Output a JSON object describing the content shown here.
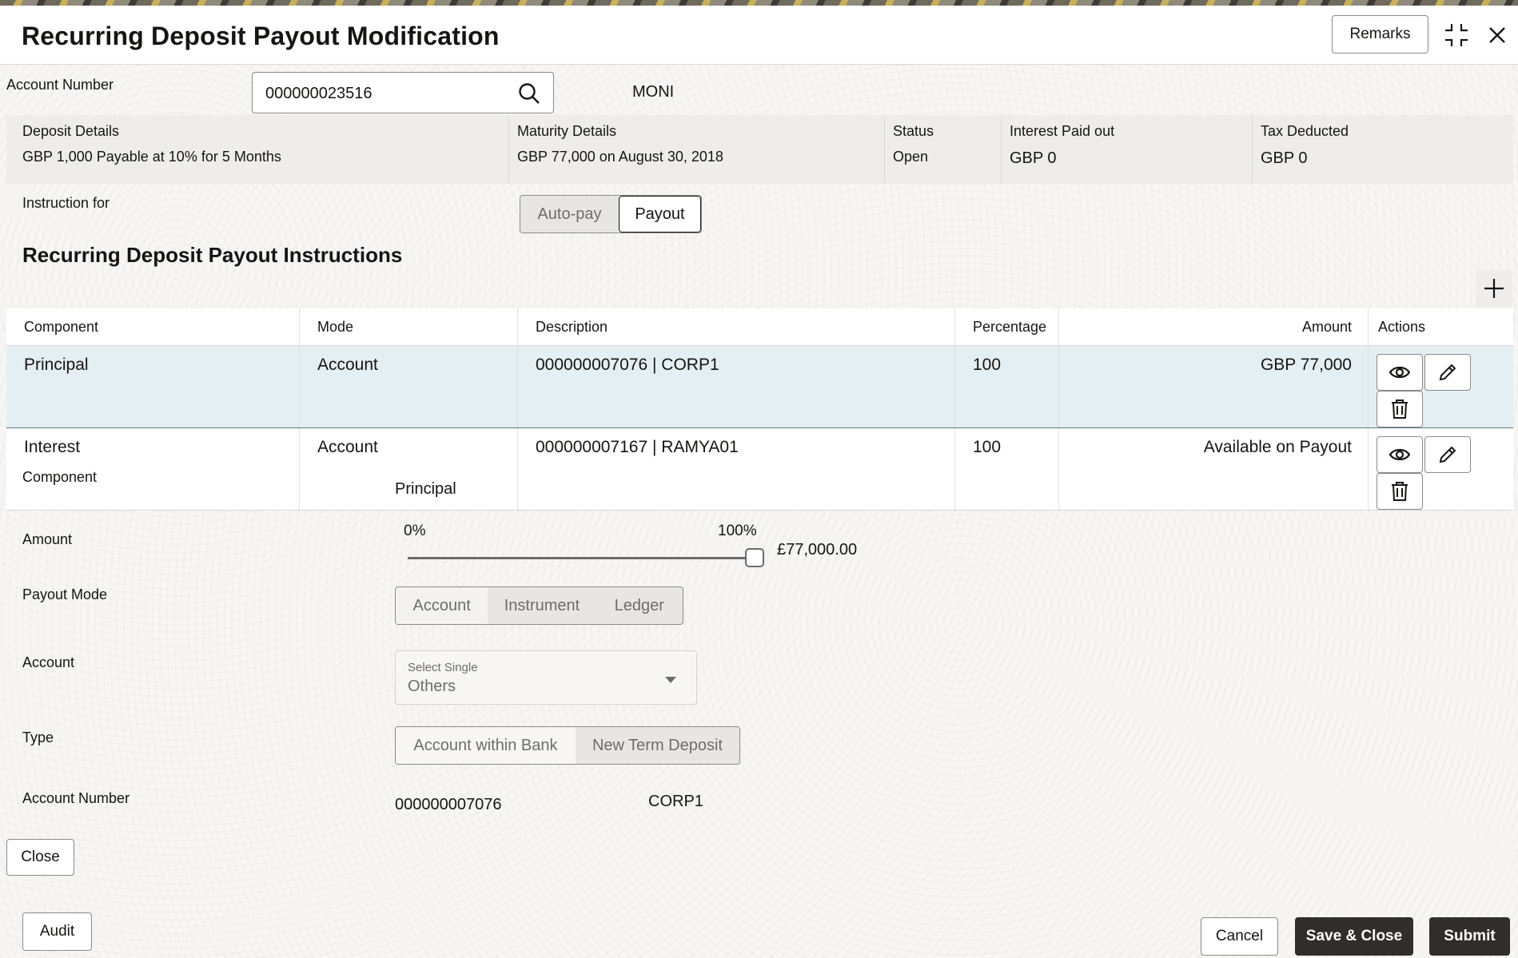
{
  "header": {
    "title": "Recurring Deposit Payout Modification",
    "remarks_label": "Remarks"
  },
  "account": {
    "label": "Account Number",
    "value": "000000023516",
    "name": "MONI"
  },
  "summary": {
    "deposit_details_label": "Deposit Details",
    "deposit_details_value": "GBP 1,000 Payable at 10% for 5 Months",
    "maturity_details_label": "Maturity Details",
    "maturity_details_value": "GBP 77,000 on August 30, 2018",
    "status_label": "Status",
    "status_value": "Open",
    "interest_paid_label": "Interest Paid out",
    "interest_paid_value": "GBP 0",
    "tax_deducted_label": "Tax Deducted",
    "tax_deducted_value": "GBP 0"
  },
  "instruction": {
    "label": "Instruction for",
    "options": [
      "Auto-pay",
      "Payout"
    ],
    "selected": "Payout"
  },
  "section_title": "Recurring Deposit Payout Instructions",
  "table": {
    "headers": [
      "Component",
      "Mode",
      "Description",
      "Percentage",
      "Amount",
      "Actions"
    ],
    "rows": [
      {
        "component": "Principal",
        "mode": "Account",
        "description": "000000007076 | CORP1",
        "percentage": "100",
        "amount": "GBP  77,000"
      },
      {
        "component": "Interest",
        "mode": "Account",
        "description": "000000007167 | RAMYA01",
        "percentage": "100",
        "amount": "Available on Payout"
      }
    ]
  },
  "form": {
    "component_label": "Component",
    "component_value": "Principal",
    "amount_label": "Amount",
    "slider_min": "0%",
    "slider_max": "100%",
    "slider_fraction": 1.0,
    "amount_value": "£77,000.00",
    "payout_mode_label": "Payout Mode",
    "payout_mode_options": [
      "Account",
      "Instrument",
      "Ledger"
    ],
    "account_label": "Account",
    "account_select_hint": "Select Single",
    "account_select_value": "Others",
    "type_label": "Type",
    "type_options": [
      "Account within Bank",
      "New Term Deposit"
    ],
    "account_number_label": "Account Number",
    "account_number_value": "000000007076",
    "account_number_name": "CORP1",
    "close_label": "Close"
  },
  "footer": {
    "audit_label": "Audit",
    "cancel_label": "Cancel",
    "save_close_label": "Save & Close",
    "submit_label": "Submit"
  }
}
